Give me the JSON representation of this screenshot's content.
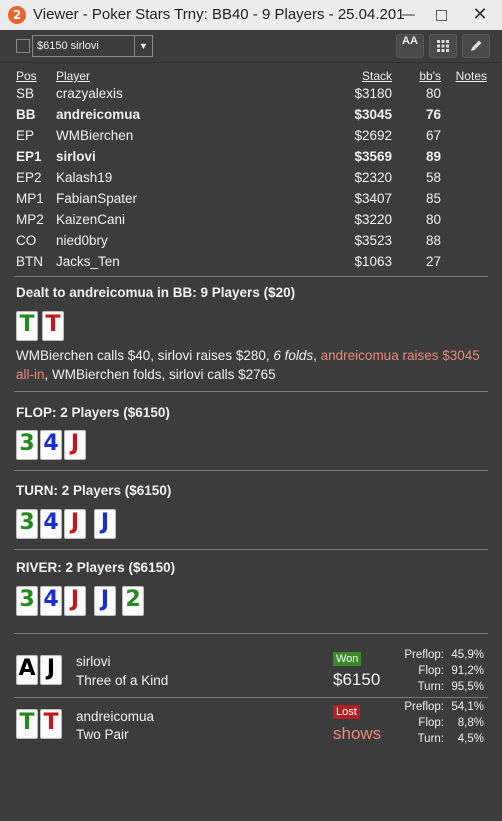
{
  "window": {
    "icon": "2",
    "title": "Viewer - Poker Stars Trny: BB40 - 9 Players - 25.04.201"
  },
  "toolbar": {
    "select_value": "$6150 sirlovi",
    "font_button": "AA",
    "grid_icon": "grid-icon",
    "edit_icon": "pencil-icon"
  },
  "table": {
    "headers": {
      "pos": "Pos",
      "player": "Player",
      "stack": "Stack",
      "bbs": "bb's",
      "notes": "Notes"
    },
    "rows": [
      {
        "pos": "SB",
        "player": "crazyalexis",
        "stack": "$3180",
        "bbs": "80",
        "bold": false
      },
      {
        "pos": "BB",
        "player": "andreicomua",
        "stack": "$3045",
        "bbs": "76",
        "bold": true
      },
      {
        "pos": "EP",
        "player": "WMBierchen",
        "stack": "$2692",
        "bbs": "67",
        "bold": false
      },
      {
        "pos": "EP1",
        "player": "sirlovi",
        "stack": "$3569",
        "bbs": "89",
        "bold": true
      },
      {
        "pos": "EP2",
        "player": "Kalash19",
        "stack": "$2320",
        "bbs": "58",
        "bold": false
      },
      {
        "pos": "MP1",
        "player": "FabianSpater",
        "stack": "$3407",
        "bbs": "85",
        "bold": false
      },
      {
        "pos": "MP2",
        "player": "KaizenCani",
        "stack": "$3220",
        "bbs": "80",
        "bold": false
      },
      {
        "pos": "CO",
        "player": "nied0bry",
        "stack": "$3523",
        "bbs": "88",
        "bold": false
      },
      {
        "pos": "BTN",
        "player": "Jacks_Ten",
        "stack": "$1063",
        "bbs": "27",
        "bold": false
      }
    ]
  },
  "preflop": {
    "title": "Dealt to andreicomua in BB: 9 Players ($20)",
    "cards": [
      {
        "rank": "T",
        "color": "green"
      },
      {
        "rank": "T",
        "color": "red"
      }
    ],
    "action_1": "WMBierchen calls $40, sirlovi raises $280, ",
    "action_2": "6 folds",
    "action_3": ", ",
    "action_4": "andreicomua raises $3045 all-in",
    "action_5": ", WMBierchen folds, sirlovi calls $2765"
  },
  "flop": {
    "title": "FLOP: 2 Players ($6150)",
    "cards": [
      {
        "rank": "3",
        "color": "green"
      },
      {
        "rank": "4",
        "color": "blue"
      },
      {
        "rank": "J",
        "color": "red"
      }
    ]
  },
  "turn": {
    "title": "TURN: 2 Players ($6150)",
    "cards": [
      {
        "rank": "3",
        "color": "green"
      },
      {
        "rank": "4",
        "color": "blue"
      },
      {
        "rank": "J",
        "color": "red"
      },
      {
        "rank": "J",
        "color": "blue"
      }
    ]
  },
  "river": {
    "title": "RIVER: 2 Players ($6150)",
    "cards": [
      {
        "rank": "3",
        "color": "green"
      },
      {
        "rank": "4",
        "color": "blue"
      },
      {
        "rank": "J",
        "color": "red"
      },
      {
        "rank": "J",
        "color": "blue"
      },
      {
        "rank": "2",
        "color": "green"
      }
    ]
  },
  "showdown": [
    {
      "cards": [
        {
          "rank": "A",
          "color": "black"
        },
        {
          "rank": "J",
          "color": "black"
        }
      ],
      "player": "sirlovi",
      "hand": "Three of a Kind",
      "result": "Won",
      "amount": "$6150",
      "stats": [
        {
          "label": "Preflop:",
          "value": "45,9%"
        },
        {
          "label": "Flop:",
          "value": "91,2%"
        },
        {
          "label": "Turn:",
          "value": "95,5%"
        }
      ]
    },
    {
      "cards": [
        {
          "rank": "T",
          "color": "green"
        },
        {
          "rank": "T",
          "color": "red"
        }
      ],
      "player": "andreicomua",
      "hand": "Two Pair",
      "result": "Lost",
      "amount": "shows",
      "stats": [
        {
          "label": "Preflop:",
          "value": "54,1%"
        },
        {
          "label": "Flop:",
          "value": "8,8%"
        },
        {
          "label": "Turn:",
          "value": "4,5%"
        }
      ]
    }
  ],
  "colors": {
    "highlight": "#e88a7a",
    "won": "#3a8a2a",
    "lost": "#b02020",
    "background": "#3c3c3c"
  }
}
